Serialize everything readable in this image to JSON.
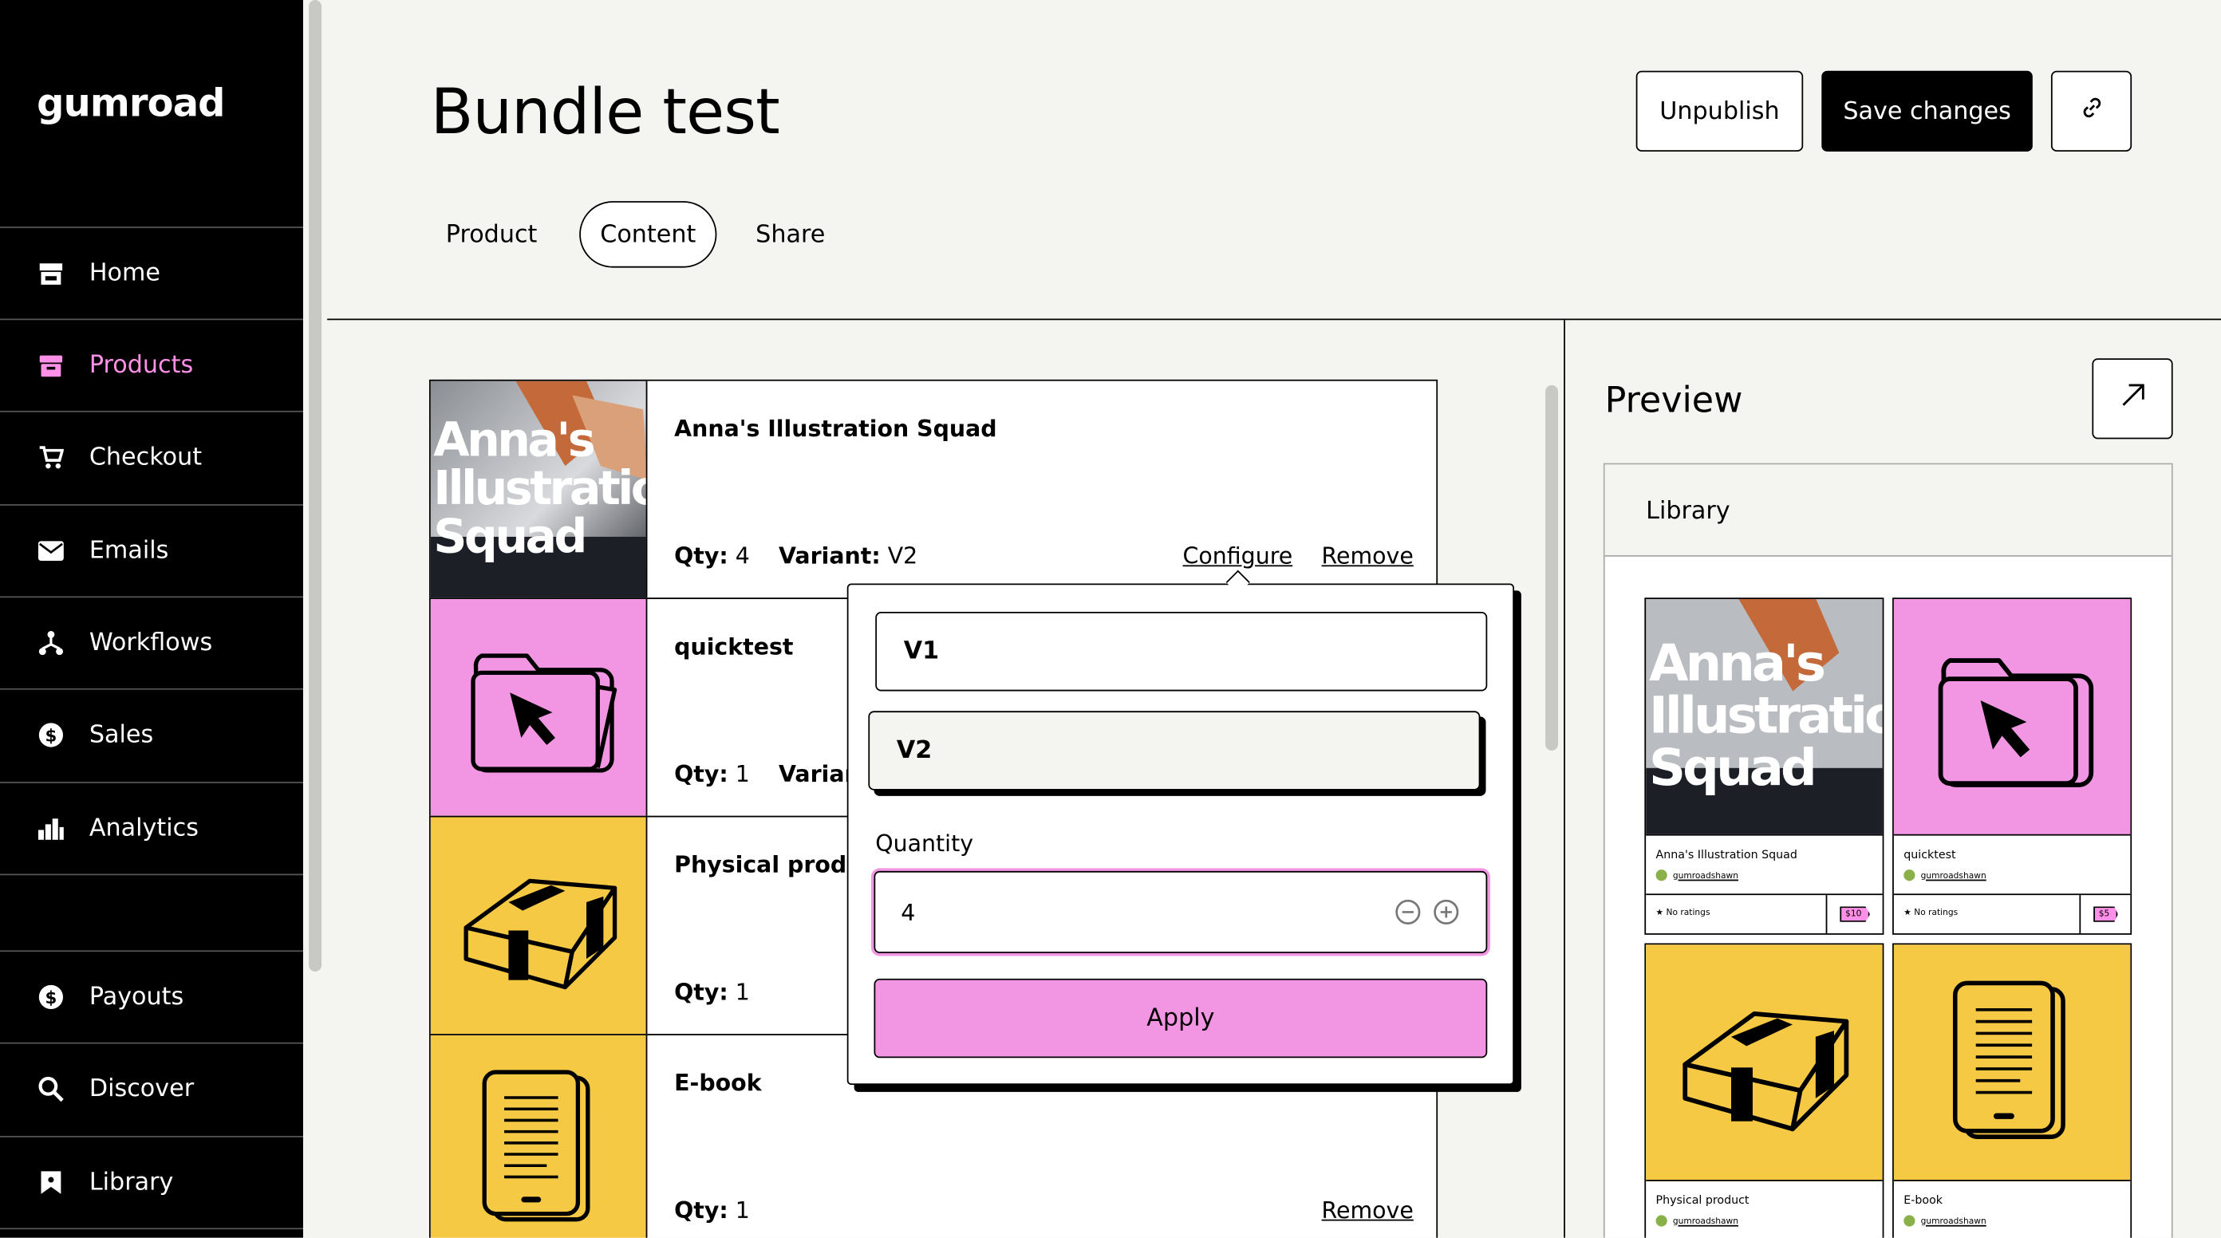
{
  "sidebar": {
    "logo": "gumroad",
    "items": [
      {
        "label": "Home",
        "icon": "store-icon"
      },
      {
        "label": "Products",
        "icon": "archive-icon"
      },
      {
        "label": "Checkout",
        "icon": "cart-icon"
      },
      {
        "label": "Emails",
        "icon": "envelope-icon"
      },
      {
        "label": "Workflows",
        "icon": "diagram-icon"
      },
      {
        "label": "Sales",
        "icon": "dollar-circle-icon"
      },
      {
        "label": "Analytics",
        "icon": "bar-chart-icon"
      }
    ],
    "bottom_items": [
      {
        "label": "Payouts",
        "icon": "dollar-circle-icon"
      },
      {
        "label": "Discover",
        "icon": "search-icon"
      },
      {
        "label": "Library",
        "icon": "bookmark-icon"
      }
    ],
    "active": "Products",
    "active_color": "#ff90e8"
  },
  "header": {
    "title": "Bundle test",
    "unpublish_label": "Unpublish",
    "save_label": "Save changes",
    "link_icon": "link-icon",
    "tabs": [
      "Product",
      "Content",
      "Share"
    ],
    "active_tab": "Content"
  },
  "bundle_products": [
    {
      "name": "Anna's Illustration Squad",
      "qty_label": "Qty:",
      "qty": "4",
      "variant_label": "Variant:",
      "variant": "V2",
      "configure": "Configure",
      "remove": "Remove",
      "cover_text": "Anna's Illustration Squad"
    },
    {
      "name": "quicktest",
      "qty_label": "Qty:",
      "qty": "1",
      "variant_label": "Variant",
      "icon": "folder-cursor-icon",
      "color": "#f296e4"
    },
    {
      "name": "Physical product",
      "qty_label": "Qty:",
      "qty": "1",
      "icon": "package-icon",
      "color": "#f6c944"
    },
    {
      "name": "E-book",
      "qty_label": "Qty:",
      "qty": "1",
      "remove": "Remove",
      "icon": "ebook-icon",
      "color": "#f6c944"
    }
  ],
  "configure_popover": {
    "options": [
      "V1",
      "V2"
    ],
    "selected": "V2",
    "quantity_label": "Quantity",
    "quantity_value": "4",
    "apply_label": "Apply",
    "accent": "#f296e4"
  },
  "preview": {
    "title": "Preview",
    "open_icon": "arrow-up-right-icon",
    "library_label": "Library",
    "cards": [
      {
        "name": "Anna's Illustration Squad",
        "creator": "gumroadshawn",
        "rating": "No ratings",
        "price": "$10"
      },
      {
        "name": "quicktest",
        "creator": "gumroadshawn",
        "rating": "No ratings",
        "price": "$5"
      },
      {
        "name": "Physical product",
        "creator": "gumroadshawn"
      },
      {
        "name": "E-book",
        "creator": "gumroadshawn"
      }
    ]
  }
}
